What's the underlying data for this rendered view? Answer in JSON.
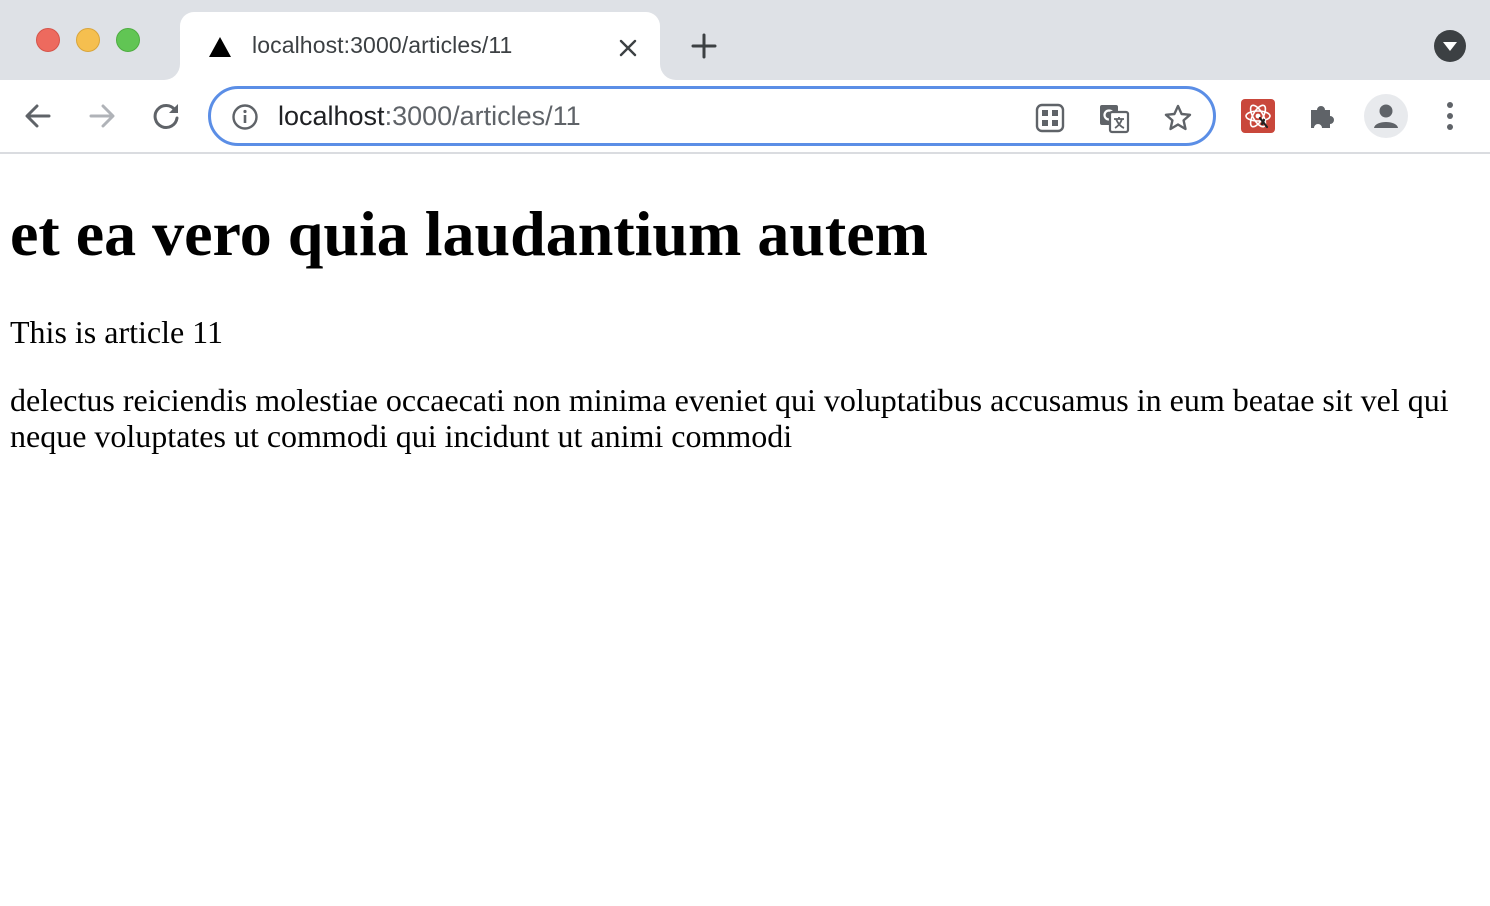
{
  "window": {
    "traffic_lights": {
      "close_color": "#ed6a5e",
      "minimize_color": "#f5bf4f",
      "maximize_color": "#61c554"
    }
  },
  "tab": {
    "title": "localhost:3000/articles/11",
    "favicon": "triangle-icon",
    "close_icon": "close-icon"
  },
  "tabstrip": {
    "new_tab_icon": "plus-icon",
    "tab_search_icon": "chevron-down-icon"
  },
  "toolbar": {
    "back_icon": "arrow-left-icon",
    "forward_icon": "arrow-right-icon",
    "reload_icon": "reload-icon",
    "omnibox": {
      "security_icon": "info-icon",
      "url_host": "localhost",
      "url_rest": ":3000/articles/11",
      "focus_color": "#5b8ee6",
      "right_icons": [
        "qr-code-icon",
        "translate-icon",
        "star-icon"
      ]
    },
    "extensions": [
      "react-devtools-icon",
      "puzzle-icon"
    ],
    "profile_icon": "person-icon",
    "menu_icon": "kebab-menu-icon"
  },
  "page": {
    "title": "et ea vero quia laudantium autem",
    "subtitle": "This is article 11",
    "body": "delectus reiciendis molestiae occaecati non minima eveniet qui voluptatibus accusamus in eum beatae sit vel qui neque voluptates ut commodi qui incidunt ut animi commodi"
  }
}
